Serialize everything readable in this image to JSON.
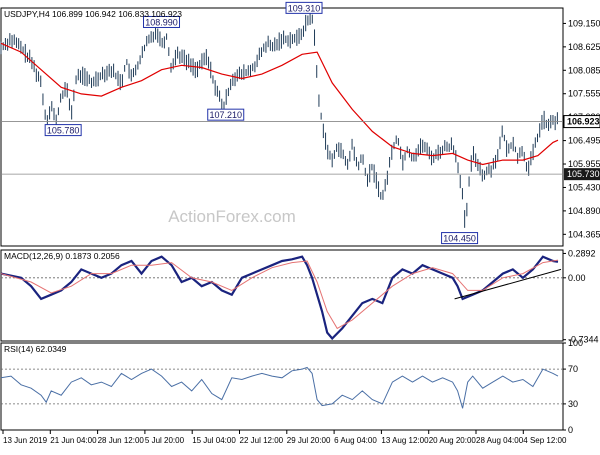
{
  "colors": {
    "background": "#ffffff",
    "frame": "#000000",
    "bars": "#1f3b57",
    "moving_average": "#e00000",
    "macd_line": "#1a237e",
    "signal_line": "#e57373",
    "rsi_line": "#4a6fa5",
    "level_line": "#666666",
    "label_box_border": "#2233aa",
    "current_price_box": "#ffffff",
    "support_box": "#1a1a1a",
    "watermark": "#c7c7c7"
  },
  "chart_data": [
    {
      "type": "ohlc",
      "title": "USDJPY,H4  106.899 106.942 106.833 106.923",
      "watermark": "ActionForex.com",
      "ylim": [
        104.1,
        109.5
      ],
      "y_ticks": [
        "109.150",
        "108.625",
        "108.085",
        "107.555",
        "107.020",
        "106.495",
        "105.955",
        "105.430",
        "104.890",
        "104.365"
      ],
      "x_ticks": [
        "13 Jun 2019",
        "21 Jun 04:00",
        "28 Jun 12:00",
        "5 Jul 20:00",
        "15 Jul 04:00",
        "22 Jul 12:00",
        "29 Jul 20:00",
        "6 Aug 04:00",
        "13 Aug 12:00",
        "20 Aug 20:00",
        "28 Aug 04:00",
        "4 Sep 12:00"
      ],
      "price_path": [
        [
          0,
          108.6
        ],
        [
          10,
          108.8
        ],
        [
          20,
          108.6
        ],
        [
          30,
          108.3
        ],
        [
          40,
          107.8
        ],
        [
          45,
          106.9
        ],
        [
          50,
          107.3
        ],
        [
          55,
          106.9
        ],
        [
          60,
          107.5
        ],
        [
          65,
          107.7
        ],
        [
          70,
          107.1
        ],
        [
          75,
          107.9
        ],
        [
          80,
          108.0
        ],
        [
          90,
          107.8
        ],
        [
          100,
          108.0
        ],
        [
          110,
          108.1
        ],
        [
          120,
          107.8
        ],
        [
          125,
          108.3
        ],
        [
          130,
          107.9
        ],
        [
          140,
          108.4
        ],
        [
          145,
          108.7
        ],
        [
          150,
          108.85
        ],
        [
          155,
          108.99
        ],
        [
          160,
          108.7
        ],
        [
          165,
          108.85
        ],
        [
          170,
          108.1
        ],
        [
          175,
          108.5
        ],
        [
          185,
          108.3
        ],
        [
          195,
          108.1
        ],
        [
          205,
          108.4
        ],
        [
          215,
          107.6
        ],
        [
          222,
          107.25
        ],
        [
          230,
          107.9
        ],
        [
          240,
          108.0
        ],
        [
          250,
          108.1
        ],
        [
          260,
          108.5
        ],
        [
          265,
          108.7
        ],
        [
          270,
          108.6
        ],
        [
          280,
          108.8
        ],
        [
          295,
          108.8
        ],
        [
          300,
          108.95
        ],
        [
          305,
          109.2
        ],
        [
          310,
          109.31
        ],
        [
          313,
          108.7
        ],
        [
          316,
          107.5
        ],
        [
          320,
          106.9
        ],
        [
          325,
          106.3
        ],
        [
          330,
          106.0
        ],
        [
          335,
          106.4
        ],
        [
          340,
          106.2
        ],
        [
          345,
          105.9
        ],
        [
          350,
          106.4
        ],
        [
          355,
          105.9
        ],
        [
          360,
          106.1
        ],
        [
          365,
          105.6
        ],
        [
          370,
          105.9
        ],
        [
          375,
          105.5
        ],
        [
          380,
          105.15
        ],
        [
          385,
          105.7
        ],
        [
          390,
          106.3
        ],
        [
          395,
          106.6
        ],
        [
          400,
          106.0
        ],
        [
          405,
          106.3
        ],
        [
          410,
          106.1
        ],
        [
          420,
          106.4
        ],
        [
          430,
          106.1
        ],
        [
          440,
          106.3
        ],
        [
          450,
          106.4
        ],
        [
          455,
          106.0
        ],
        [
          460,
          105.2
        ],
        [
          463,
          104.45
        ],
        [
          466,
          105.5
        ],
        [
          470,
          106.2
        ],
        [
          475,
          106.0
        ],
        [
          480,
          105.7
        ],
        [
          490,
          105.9
        ],
        [
          495,
          106.2
        ],
        [
          500,
          106.7
        ],
        [
          505,
          106.2
        ],
        [
          510,
          106.5
        ],
        [
          515,
          106.1
        ],
        [
          520,
          106.3
        ],
        [
          525,
          105.8
        ],
        [
          530,
          106.2
        ],
        [
          535,
          106.6
        ],
        [
          540,
          107.0
        ],
        [
          545,
          106.8
        ],
        [
          550,
          106.95
        ],
        [
          555,
          106.92
        ]
      ],
      "moving_average": [
        [
          0,
          108.7
        ],
        [
          20,
          108.5
        ],
        [
          40,
          108.1
        ],
        [
          60,
          107.7
        ],
        [
          80,
          107.55
        ],
        [
          100,
          107.5
        ],
        [
          120,
          107.7
        ],
        [
          140,
          107.85
        ],
        [
          160,
          108.1
        ],
        [
          180,
          108.2
        ],
        [
          200,
          108.15
        ],
        [
          220,
          108.0
        ],
        [
          240,
          107.9
        ],
        [
          260,
          108.0
        ],
        [
          280,
          108.2
        ],
        [
          300,
          108.45
        ],
        [
          315,
          108.5
        ],
        [
          330,
          107.8
        ],
        [
          350,
          107.2
        ],
        [
          370,
          106.7
        ],
        [
          390,
          106.35
        ],
        [
          410,
          106.2
        ],
        [
          430,
          106.15
        ],
        [
          450,
          106.2
        ],
        [
          465,
          106.05
        ],
        [
          480,
          105.95
        ],
        [
          500,
          106.05
        ],
        [
          520,
          106.05
        ],
        [
          535,
          106.15
        ],
        [
          550,
          106.45
        ],
        [
          555,
          106.5
        ]
      ],
      "annotations": [
        {
          "label": "108.990",
          "time": 143,
          "price": 108.99,
          "anchor": "above"
        },
        {
          "label": "109.310",
          "time": 285,
          "price": 109.31,
          "anchor": "above"
        },
        {
          "label": "105.780",
          "time": 45,
          "price": 106.9,
          "anchor": "below"
        },
        {
          "label": "107.210",
          "time": 207,
          "price": 107.25,
          "anchor": "below"
        },
        {
          "label": "104.450",
          "time": 440,
          "price": 104.45,
          "anchor": "below"
        }
      ],
      "current_price": {
        "label": "106.923",
        "price": 106.923
      },
      "support_level": {
        "label": "105.730",
        "price": 105.73
      }
    },
    {
      "type": "line",
      "title": "MACD(12,26,9)  0.1873  0.2056",
      "ylim": [
        -0.75,
        0.33
      ],
      "y_ticks": [
        {
          "label": "0.2892",
          "value": 0.2892
        },
        {
          "label": "0.00",
          "value": 0.0
        },
        {
          "label": "-0.7344",
          "value": -0.7344
        }
      ],
      "series": [
        {
          "role": "macd",
          "values": [
            [
              0,
              0.05
            ],
            [
              20,
              0.0
            ],
            [
              30,
              -0.1
            ],
            [
              40,
              -0.25
            ],
            [
              50,
              -0.2
            ],
            [
              60,
              -0.15
            ],
            [
              70,
              -0.05
            ],
            [
              80,
              0.1
            ],
            [
              90,
              0.05
            ],
            [
              100,
              0.0
            ],
            [
              110,
              0.05
            ],
            [
              120,
              0.15
            ],
            [
              130,
              0.2
            ],
            [
              140,
              0.05
            ],
            [
              150,
              0.2
            ],
            [
              160,
              0.25
            ],
            [
              170,
              0.15
            ],
            [
              180,
              -0.05
            ],
            [
              190,
              0.0
            ],
            [
              200,
              -0.1
            ],
            [
              210,
              -0.05
            ],
            [
              220,
              -0.15
            ],
            [
              230,
              -0.2
            ],
            [
              240,
              0.0
            ],
            [
              250,
              0.05
            ],
            [
              260,
              0.1
            ],
            [
              270,
              0.15
            ],
            [
              280,
              0.2
            ],
            [
              290,
              0.22
            ],
            [
              300,
              0.25
            ],
            [
              305,
              0.15
            ],
            [
              310,
              0.0
            ],
            [
              315,
              -0.2
            ],
            [
              320,
              -0.4
            ],
            [
              325,
              -0.65
            ],
            [
              330,
              -0.72
            ],
            [
              340,
              -0.6
            ],
            [
              350,
              -0.45
            ],
            [
              360,
              -0.3
            ],
            [
              370,
              -0.25
            ],
            [
              380,
              -0.3
            ],
            [
              390,
              0.0
            ],
            [
              400,
              0.1
            ],
            [
              410,
              0.05
            ],
            [
              420,
              0.15
            ],
            [
              430,
              0.1
            ],
            [
              440,
              0.05
            ],
            [
              450,
              0.0
            ],
            [
              455,
              -0.1
            ],
            [
              460,
              -0.25
            ],
            [
              470,
              -0.2
            ],
            [
              480,
              -0.15
            ],
            [
              490,
              -0.05
            ],
            [
              500,
              0.05
            ],
            [
              510,
              0.1
            ],
            [
              520,
              0.0
            ],
            [
              530,
              0.1
            ],
            [
              540,
              0.25
            ],
            [
              550,
              0.2
            ],
            [
              555,
              0.19
            ]
          ]
        },
        {
          "role": "signal",
          "values": [
            [
              0,
              0.05
            ],
            [
              30,
              -0.05
            ],
            [
              50,
              -0.18
            ],
            [
              70,
              -0.1
            ],
            [
              90,
              0.05
            ],
            [
              110,
              0.05
            ],
            [
              130,
              0.15
            ],
            [
              150,
              0.15
            ],
            [
              170,
              0.18
            ],
            [
              190,
              0.0
            ],
            [
              210,
              -0.05
            ],
            [
              230,
              -0.15
            ],
            [
              250,
              0.0
            ],
            [
              270,
              0.12
            ],
            [
              290,
              0.18
            ],
            [
              305,
              0.2
            ],
            [
              315,
              -0.05
            ],
            [
              325,
              -0.4
            ],
            [
              335,
              -0.6
            ],
            [
              350,
              -0.5
            ],
            [
              370,
              -0.3
            ],
            [
              390,
              -0.1
            ],
            [
              410,
              0.05
            ],
            [
              430,
              0.12
            ],
            [
              450,
              0.05
            ],
            [
              465,
              -0.15
            ],
            [
              480,
              -0.15
            ],
            [
              500,
              0.0
            ],
            [
              520,
              0.05
            ],
            [
              540,
              0.18
            ],
            [
              555,
              0.21
            ]
          ]
        }
      ],
      "trendline": [
        [
          452,
          -0.25
        ],
        [
          558,
          0.1
        ]
      ]
    },
    {
      "type": "line",
      "title": "RSI(14) 62.0349",
      "ylim": [
        0,
        100
      ],
      "y_ticks": [
        {
          "label": "100",
          "value": 100
        },
        {
          "label": "70",
          "value": 70
        },
        {
          "label": "30",
          "value": 30
        },
        {
          "label": "0",
          "value": 0
        }
      ],
      "series": [
        {
          "role": "rsi",
          "values": [
            [
              0,
              60
            ],
            [
              10,
              62
            ],
            [
              20,
              52
            ],
            [
              30,
              48
            ],
            [
              40,
              40
            ],
            [
              45,
              32
            ],
            [
              50,
              45
            ],
            [
              60,
              40
            ],
            [
              70,
              55
            ],
            [
              80,
              60
            ],
            [
              90,
              52
            ],
            [
              100,
              55
            ],
            [
              110,
              50
            ],
            [
              120,
              65
            ],
            [
              130,
              58
            ],
            [
              140,
              65
            ],
            [
              150,
              70
            ],
            [
              160,
              62
            ],
            [
              170,
              50
            ],
            [
              180,
              55
            ],
            [
              190,
              45
            ],
            [
              200,
              58
            ],
            [
              210,
              42
            ],
            [
              220,
              35
            ],
            [
              230,
              60
            ],
            [
              240,
              58
            ],
            [
              250,
              62
            ],
            [
              260,
              65
            ],
            [
              270,
              62
            ],
            [
              280,
              60
            ],
            [
              290,
              68
            ],
            [
              300,
              70
            ],
            [
              305,
              72
            ],
            [
              310,
              65
            ],
            [
              315,
              35
            ],
            [
              320,
              28
            ],
            [
              330,
              30
            ],
            [
              340,
              40
            ],
            [
              350,
              35
            ],
            [
              360,
              45
            ],
            [
              370,
              35
            ],
            [
              380,
              30
            ],
            [
              390,
              55
            ],
            [
              400,
              62
            ],
            [
              410,
              55
            ],
            [
              420,
              62
            ],
            [
              430,
              55
            ],
            [
              440,
              60
            ],
            [
              450,
              55
            ],
            [
              455,
              45
            ],
            [
              460,
              25
            ],
            [
              465,
              55
            ],
            [
              470,
              62
            ],
            [
              480,
              48
            ],
            [
              490,
              55
            ],
            [
              500,
              62
            ],
            [
              510,
              55
            ],
            [
              520,
              58
            ],
            [
              530,
              50
            ],
            [
              540,
              70
            ],
            [
              550,
              65
            ],
            [
              555,
              62
            ]
          ]
        }
      ],
      "levels": [
        70,
        30
      ]
    }
  ]
}
